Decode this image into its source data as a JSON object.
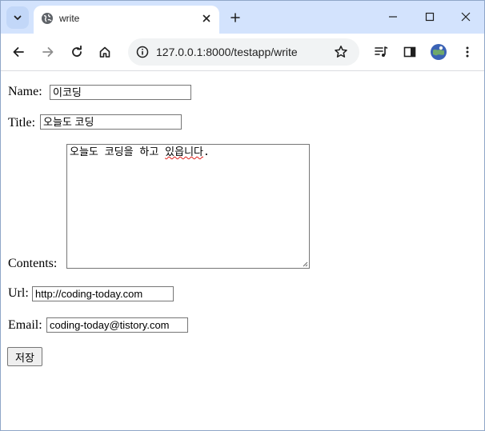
{
  "browser": {
    "tab": {
      "title": "write"
    },
    "address_bar": {
      "url": "127.0.0.1:8000/testapp/write"
    }
  },
  "form": {
    "name": {
      "label": "Name:",
      "value": "이코딩"
    },
    "title": {
      "label": "Title:",
      "value": "오늘도 코딩"
    },
    "contents": {
      "label": "Contents:",
      "value_pre": "오늘도 코딩을 하고 ",
      "value_err": "있읍니다",
      "value_post": "."
    },
    "url": {
      "label": "Url:",
      "value": "http://coding-today.com"
    },
    "email": {
      "label": "Email:",
      "value": "coding-today@tistory.com"
    },
    "submit_label": "저장"
  },
  "colors": {
    "tabstrip": "#d3e3fd",
    "spellcheck": "#e0201b"
  }
}
